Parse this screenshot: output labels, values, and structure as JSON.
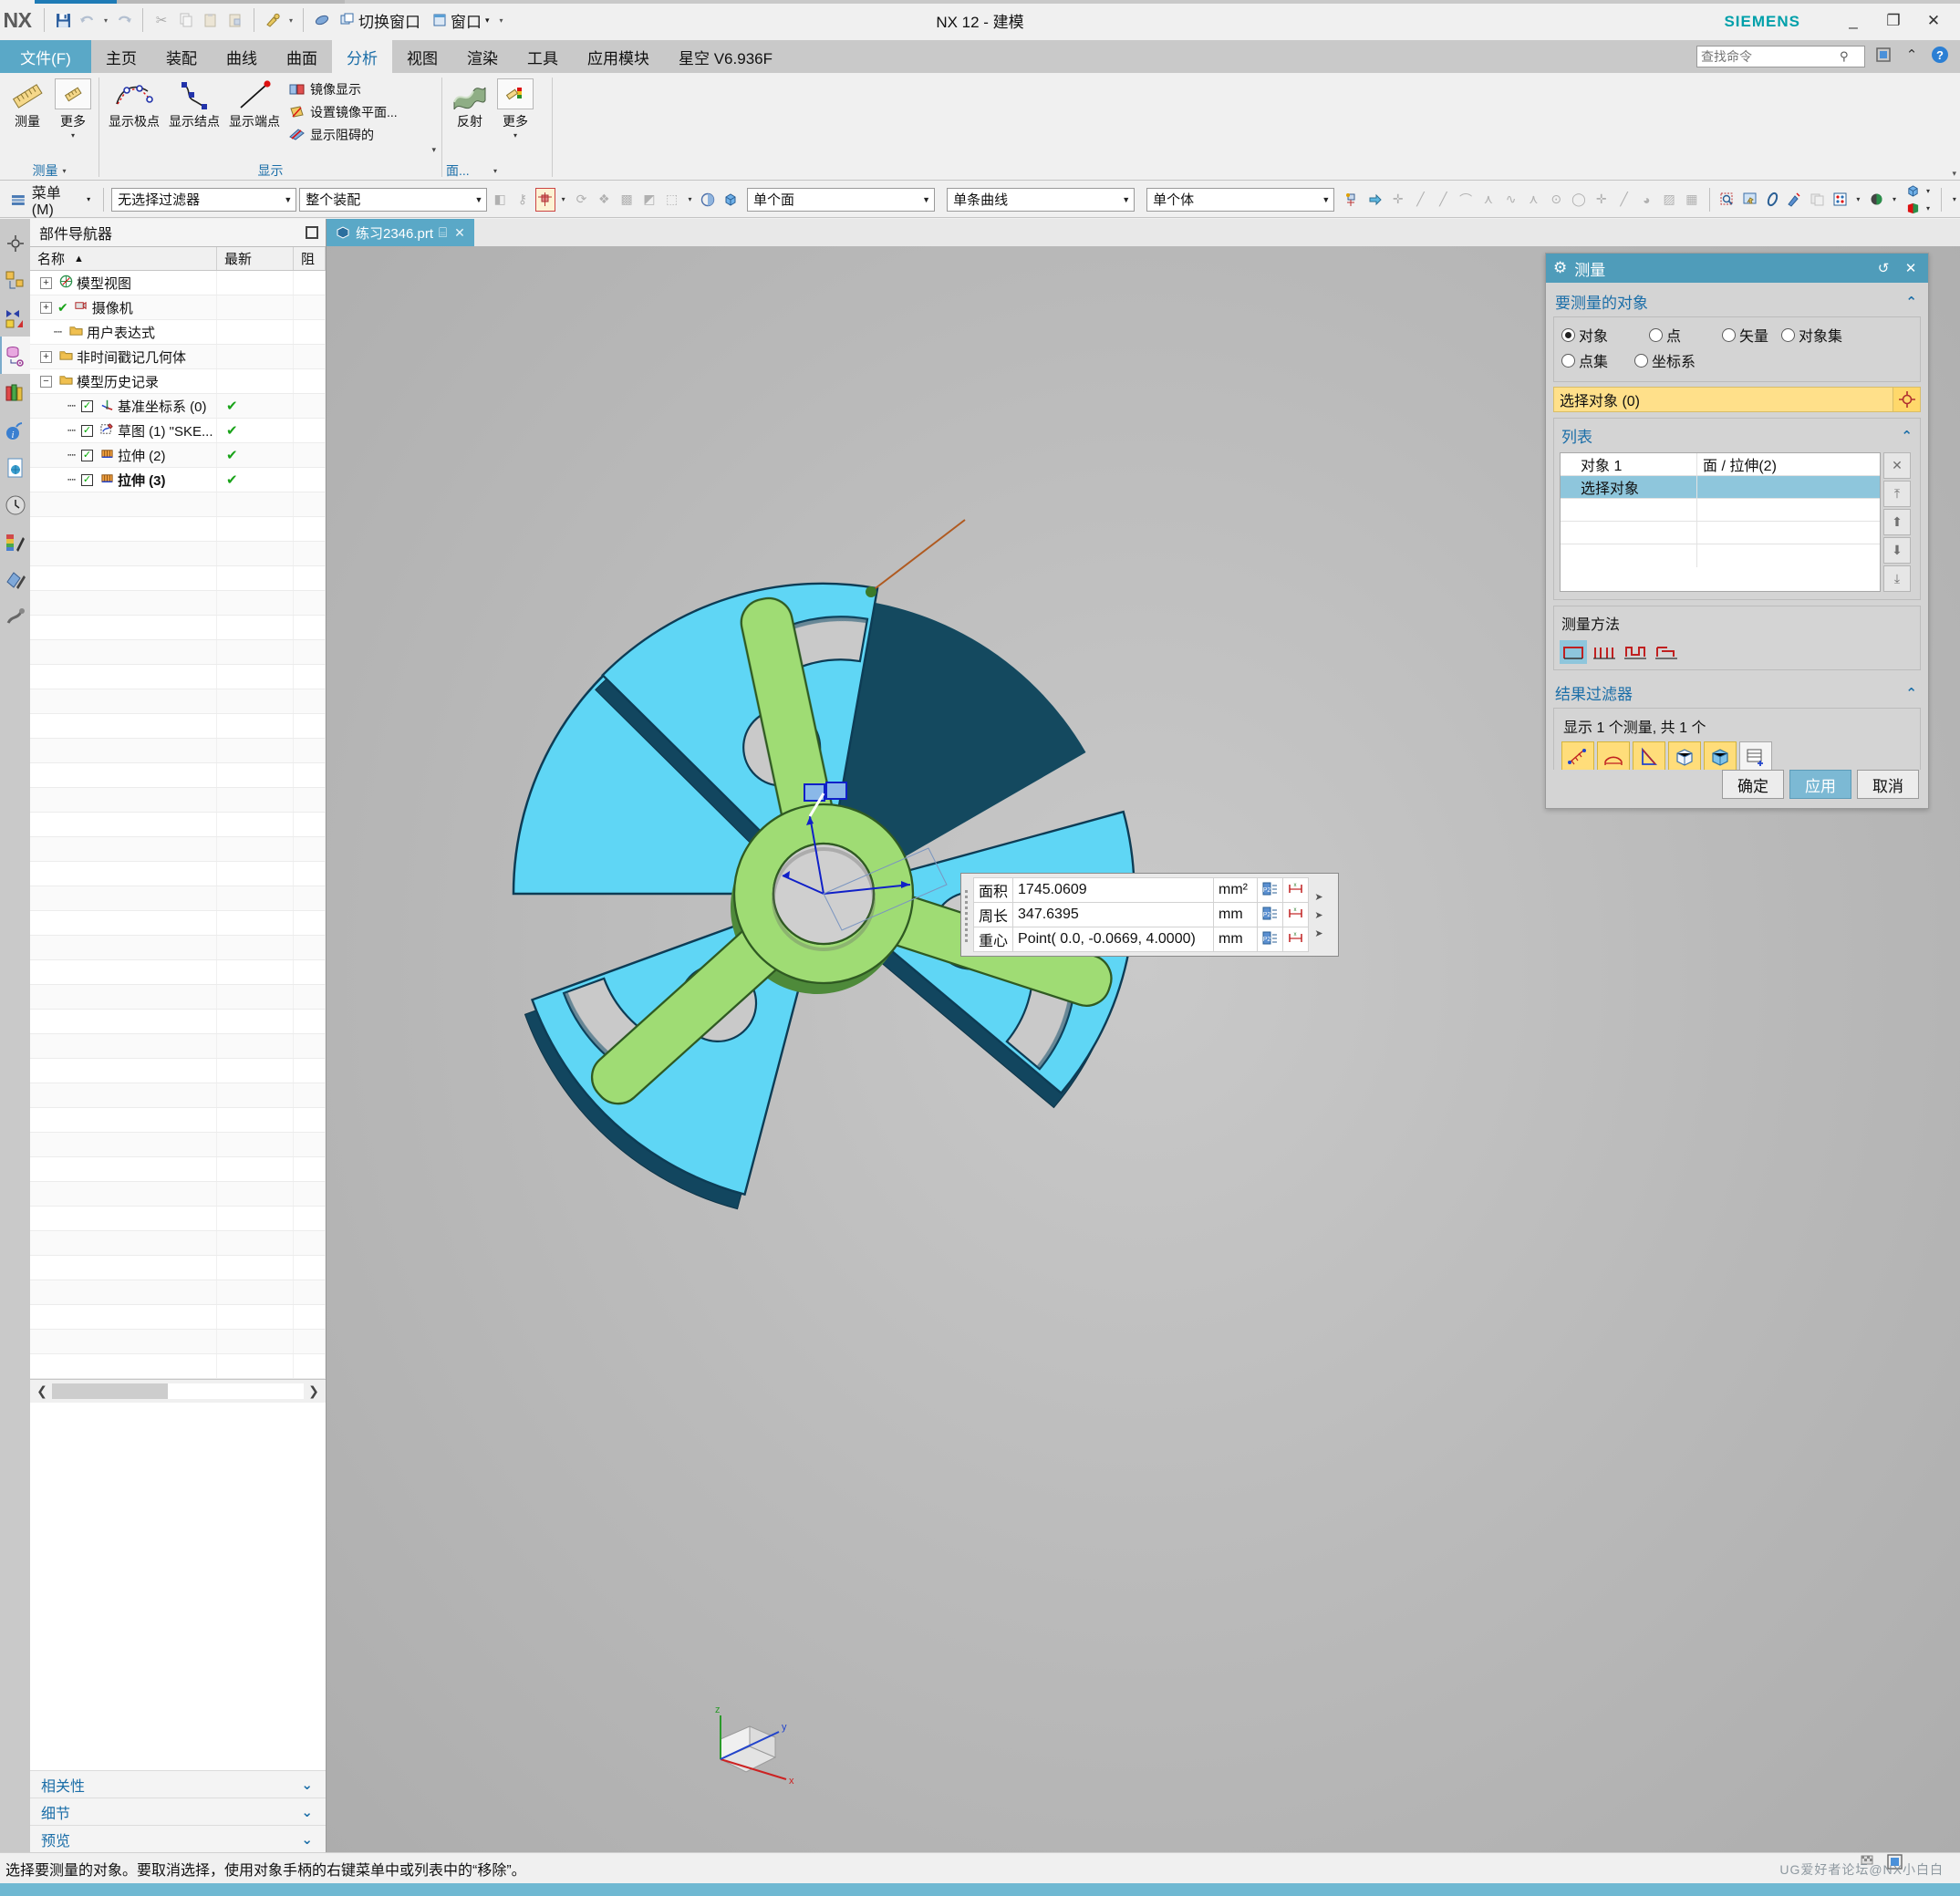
{
  "window": {
    "title": "NX 12 - 建模",
    "brand": "SIEMENS",
    "minimize": "_",
    "maximize": "❐",
    "close": "✕"
  },
  "quick_access": {
    "logo": "NX",
    "buttons": [
      {
        "name": "save-icon",
        "glyph": "💾"
      },
      {
        "name": "undo-icon",
        "glyph": "↰"
      },
      {
        "name": "undo-dropdown-icon",
        "glyph": "▾"
      },
      {
        "name": "redo-icon",
        "glyph": "↱"
      },
      {
        "name": "cut-icon",
        "glyph": "✂"
      },
      {
        "name": "copy-icon",
        "glyph": "❐"
      },
      {
        "name": "paste-icon",
        "glyph": "📋"
      },
      {
        "name": "paste-special-icon",
        "glyph": "❒"
      },
      {
        "name": "undo-history-icon",
        "glyph": "🗝"
      },
      {
        "name": "undo-history-dropdown-icon",
        "glyph": "▾"
      },
      {
        "name": "erase-icon",
        "glyph": "🖌"
      }
    ],
    "switch_window_label": "切换窗口",
    "window_label": "窗口",
    "dropdown_glyph": "▾",
    "more_glyph": "▾"
  },
  "tabs": {
    "file": "文件(F)",
    "items": [
      {
        "label": "主页",
        "active": false
      },
      {
        "label": "装配",
        "active": false
      },
      {
        "label": "曲线",
        "active": false
      },
      {
        "label": "曲面",
        "active": false
      },
      {
        "label": "分析",
        "active": true
      },
      {
        "label": "视图",
        "active": false
      },
      {
        "label": "渲染",
        "active": false
      },
      {
        "label": "工具",
        "active": false
      },
      {
        "label": "应用模块",
        "active": false
      },
      {
        "label": "星空 V6.936F",
        "active": false
      }
    ]
  },
  "search": {
    "placeholder": "查找命令",
    "icon": "search-icon"
  },
  "header_icons": [
    {
      "name": "window-mode-icon",
      "glyph": "▣"
    },
    {
      "name": "collapse-ribbon-icon",
      "glyph": "⌃"
    },
    {
      "name": "help-icon",
      "glyph": "?"
    }
  ],
  "ribbon": {
    "groups": [
      {
        "name": "measure",
        "label": "测量",
        "label_arrow": "▾",
        "buttons": [
          {
            "name": "measure-button",
            "caption": "测量",
            "icon": "ruler-icon",
            "framed": false,
            "dropdown": false
          },
          {
            "name": "measure-more-button",
            "caption": "更多",
            "icon": "ruler-small-icon",
            "framed": true,
            "dropdown": true
          }
        ]
      },
      {
        "name": "display",
        "label": "显示",
        "label_arrow": "▾",
        "buttons": [
          {
            "name": "show-poles-button",
            "caption": "显示极点",
            "icon": "poles-icon",
            "framed": false,
            "dropdown": false
          },
          {
            "name": "show-knots-button",
            "caption": "显示结点",
            "icon": "knots-icon",
            "framed": false,
            "dropdown": false
          },
          {
            "name": "show-endpoints-button",
            "caption": "显示端点",
            "icon": "endpoint-icon",
            "framed": false,
            "dropdown": false
          }
        ],
        "small_items": [
          {
            "name": "mirror-display-item",
            "label": "镜像显示",
            "icon": "mirror-display-icon"
          },
          {
            "name": "set-mirror-plane-item",
            "label": "设置镜像平面...",
            "icon": "mirror-plane-icon"
          },
          {
            "name": "show-obstructed-item",
            "label": "显示阻碍的",
            "icon": "obstructed-icon"
          }
        ]
      },
      {
        "name": "face",
        "label": "面...",
        "label_arrow": "▾",
        "buttons": [
          {
            "name": "reflection-button",
            "caption": "反射",
            "icon": "reflection-icon",
            "framed": false,
            "dropdown": false
          },
          {
            "name": "face-more-button",
            "caption": "更多",
            "icon": "face-more-icon",
            "framed": true,
            "dropdown": true
          }
        ]
      }
    ],
    "far_arrow": "▾"
  },
  "selection_bar": {
    "menu_label": "菜单(M)",
    "menu_icon": "menu-icon",
    "menu_arrow": "▾",
    "filter_combo": {
      "value": "无选择过滤器",
      "arrow": "▼"
    },
    "scope_combo": {
      "value": "整个装配",
      "arrow": "▼"
    },
    "face_combo": {
      "value": "单个面",
      "arrow": "▼"
    },
    "curve_combo": {
      "value": "单条曲线",
      "arrow": "▼"
    },
    "body_combo": {
      "value": "单个体",
      "arrow": "▼"
    },
    "icons_group1": [
      {
        "name": "select-general-icon",
        "glyph": "◧",
        "state": "disabled"
      },
      {
        "name": "select-feature-icon",
        "glyph": "⚷",
        "state": "disabled"
      },
      {
        "name": "snap-point-icon",
        "glyph": "⊹",
        "state": "highlight"
      },
      {
        "name": "snap-dropdown-icon",
        "glyph": "▾",
        "state": "normal"
      },
      {
        "name": "select-component-icon",
        "glyph": "⟳",
        "state": "disabled"
      },
      {
        "name": "select-assembly-icon",
        "glyph": "❖",
        "state": "disabled"
      },
      {
        "name": "select-mesh-icon",
        "glyph": "▩",
        "state": "disabled"
      },
      {
        "name": "select-body2-icon",
        "glyph": "◩",
        "state": "disabled"
      },
      {
        "name": "rect-select-icon",
        "glyph": "⬚",
        "state": "normal"
      },
      {
        "name": "rect-select-dropdown-icon",
        "glyph": "▾",
        "state": "normal"
      },
      {
        "name": "face-color-icon",
        "glyph": "◍",
        "state": "normal"
      },
      {
        "name": "solid-body-icon",
        "glyph": "⬢",
        "state": "normal"
      }
    ],
    "icons_group2": [
      {
        "name": "snap-filter-icon",
        "glyph": "⚵"
      },
      {
        "name": "snap-point-arrow-icon",
        "glyph": "➩"
      },
      {
        "name": "snap-center-icon",
        "glyph": "✛"
      },
      {
        "name": "snap-endpoint-icon",
        "glyph": "╱"
      },
      {
        "name": "snap-midpoint-icon",
        "glyph": "╱"
      },
      {
        "name": "snap-intersection-icon",
        "glyph": "〜"
      },
      {
        "name": "snap-arc-center-icon",
        "glyph": "⋏"
      },
      {
        "name": "snap-quadrant-icon",
        "glyph": "∿"
      },
      {
        "name": "snap-tangent-icon",
        "glyph": "⋀"
      },
      {
        "name": "snap-point-on-curve-icon",
        "glyph": "⊙"
      },
      {
        "name": "snap-circle-icon",
        "glyph": "◯"
      },
      {
        "name": "snap-plus-icon",
        "glyph": "✛"
      },
      {
        "name": "snap-line-icon",
        "glyph": "╱"
      },
      {
        "name": "snap-face-icon",
        "glyph": "◕"
      },
      {
        "name": "snap-surface-icon",
        "glyph": "▨"
      },
      {
        "name": "snap-grid-icon",
        "glyph": "▦"
      }
    ],
    "icons_group3": [
      {
        "name": "zoom-fit-icon",
        "glyph": "🔍"
      },
      {
        "name": "pan-icon",
        "glyph": "✋"
      },
      {
        "name": "rotate-icon",
        "glyph": "⟲"
      },
      {
        "name": "clear-icon",
        "glyph": "🧹"
      },
      {
        "name": "layer-icon",
        "glyph": "▤"
      },
      {
        "name": "grid-icon",
        "glyph": "▦"
      },
      {
        "name": "grid-dropdown-icon",
        "glyph": "▾"
      },
      {
        "name": "render-style-icon",
        "glyph": "◕"
      },
      {
        "name": "render-dropdown-icon",
        "glyph": "▾"
      },
      {
        "name": "view-orient-icon",
        "glyph": "⬢"
      },
      {
        "name": "view-orient-dropdown-icon",
        "glyph": "▾"
      },
      {
        "name": "view-section-icon",
        "glyph": "◩"
      },
      {
        "name": "view-section-dropdown-icon",
        "glyph": "▾"
      },
      {
        "name": "overflow-icon",
        "glyph": "▾"
      }
    ]
  },
  "rail": [
    {
      "name": "rail-assembly-navigator",
      "glyph": "✪",
      "active": false
    },
    {
      "name": "rail-assembly-icon",
      "glyph": "◱",
      "active": false
    },
    {
      "name": "rail-constraint-icon",
      "glyph": "◨",
      "active": false
    },
    {
      "name": "rail-part-navigator",
      "glyph": "◫",
      "active": true
    },
    {
      "name": "rail-reuse-library",
      "glyph": "▥",
      "active": false
    },
    {
      "name": "rail-hd3d-tools",
      "glyph": "ⓘ",
      "active": false
    },
    {
      "name": "rail-web-browser",
      "glyph": "🌐",
      "active": false
    },
    {
      "name": "rail-history",
      "glyph": "🕐",
      "active": false
    },
    {
      "name": "rail-system-scene",
      "glyph": "🎨",
      "active": false
    },
    {
      "name": "rail-system-materials",
      "glyph": "✨",
      "active": false
    },
    {
      "name": "rail-system-visual",
      "glyph": "🔧",
      "active": false
    }
  ],
  "part_navigator": {
    "title": "部件导航器",
    "restore_icon": "restore-icon",
    "columns": [
      "名称",
      "最新",
      "阻"
    ],
    "sort_arrow": "▲",
    "rows": [
      {
        "indent": 0,
        "expander": "+",
        "checkbox": null,
        "icon": "model-views-icon",
        "label": "模型视图",
        "updated": "",
        "bold": false
      },
      {
        "indent": 0,
        "expander": "+",
        "checkbox": null,
        "icon": "camera-icon",
        "label": "摄像机",
        "updated": "",
        "bold": false,
        "prefix_check": true
      },
      {
        "indent": 1,
        "expander": null,
        "checkbox": null,
        "icon": "folder-icon",
        "label": "用户表达式",
        "updated": "",
        "bold": false
      },
      {
        "indent": 0,
        "expander": "+",
        "checkbox": null,
        "icon": "folder-icon",
        "label": "非时间戳记几何体",
        "updated": "",
        "bold": false
      },
      {
        "indent": 0,
        "expander": "−",
        "checkbox": null,
        "icon": "folder-icon",
        "label": "模型历史记录",
        "updated": "",
        "bold": false
      },
      {
        "indent": 2,
        "expander": null,
        "checkbox": "✓",
        "icon": "datum-csys-icon",
        "label": "基准坐标系 (0)",
        "updated": "✔",
        "bold": false
      },
      {
        "indent": 2,
        "expander": null,
        "checkbox": "✓",
        "icon": "sketch-icon",
        "label": "草图 (1) \"SKE...",
        "updated": "✔",
        "bold": false
      },
      {
        "indent": 2,
        "expander": null,
        "checkbox": "✓",
        "icon": "extrude-icon",
        "label": "拉伸 (2)",
        "updated": "✔",
        "bold": false
      },
      {
        "indent": 2,
        "expander": null,
        "checkbox": "✓",
        "icon": "extrude-icon",
        "label": "拉伸 (3)",
        "updated": "✔",
        "bold": true
      }
    ],
    "empty_rows": 36,
    "hscroll": {
      "left_arrow": "❮",
      "right_arrow": "❯"
    },
    "sections": [
      {
        "name": "dependency-section",
        "label": "相关性",
        "chev": "⌄"
      },
      {
        "name": "details-section",
        "label": "细节",
        "chev": "⌄"
      },
      {
        "name": "preview-section",
        "label": "预览",
        "chev": "⌄"
      }
    ]
  },
  "document_tab": {
    "icon": "part-file-icon",
    "label": "练习2346.prt",
    "modified_glyph": "⌸",
    "close_glyph": "✕"
  },
  "measurement_result": {
    "rows": [
      {
        "label": "面积",
        "value": "1745.0609",
        "unit": "mm²",
        "icon1": "point-label-icon",
        "icon2": "dimension-icon"
      },
      {
        "label": "周长",
        "value": "347.6395",
        "unit": "mm",
        "icon1": "point-label-icon",
        "icon2": "dimension-icon"
      },
      {
        "label": "重心",
        "value": "Point( 0.0, -0.0669, 4.0000)",
        "unit": "mm",
        "icon1": "point-label-icon",
        "icon2": "dimension-icon"
      }
    ],
    "side_arrows": [
      "➤",
      "➤",
      "➤"
    ]
  },
  "dialog": {
    "title": "测量",
    "title_icon": "gear-icon",
    "reset_icon": "↺",
    "close_icon": "✕",
    "objects_section": {
      "header": "要测量的对象",
      "chev": "⌃",
      "radios": [
        {
          "name": "radio-object",
          "label": "对象",
          "selected": true
        },
        {
          "name": "radio-point",
          "label": "点",
          "selected": false
        },
        {
          "name": "radio-vector",
          "label": "矢量",
          "selected": false
        },
        {
          "name": "radio-object-set",
          "label": "对象集",
          "selected": false
        },
        {
          "name": "radio-point-set",
          "label": "点集",
          "selected": false
        },
        {
          "name": "radio-csys",
          "label": "坐标系",
          "selected": false
        }
      ],
      "select_row": {
        "label": "选择对象 (0)",
        "target_icon": "crosshair-icon"
      }
    },
    "list_section": {
      "header": "列表",
      "chev": "⌃",
      "rows": [
        {
          "c1": "对象 1",
          "c2": "面 / 拉伸(2)",
          "selected": false
        },
        {
          "c1": "选择对象",
          "c2": "",
          "selected": true
        },
        {
          "c1": "",
          "c2": "",
          "selected": false
        },
        {
          "c1": "",
          "c2": "",
          "selected": false
        },
        {
          "c1": "",
          "c2": "",
          "selected": false
        }
      ],
      "side_buttons": [
        {
          "name": "remove-item-button",
          "glyph": "✕"
        },
        {
          "name": "move-to-top-button",
          "glyph": "⤒"
        },
        {
          "name": "move-up-button",
          "glyph": "⬆"
        },
        {
          "name": "move-down-button",
          "glyph": "⬇"
        },
        {
          "name": "move-to-bottom-button",
          "glyph": "⤓"
        }
      ]
    },
    "method_section": {
      "header": "测量方法",
      "icons": [
        {
          "name": "method-simple-icon",
          "glyph": "⊓",
          "active": true
        },
        {
          "name": "method-parallel-icon",
          "glyph": "⑊",
          "active": false
        },
        {
          "name": "method-chain-icon",
          "glyph": "⊔",
          "active": false
        },
        {
          "name": "method-step-icon",
          "glyph": "⊐",
          "active": false
        }
      ]
    },
    "result_filter": {
      "header": "结果过滤器",
      "chev": "⌃",
      "summary": "显示 1 个测量, 共 1 个",
      "icons": [
        {
          "name": "filter-distance-icon",
          "glyph": "⋰",
          "highlight": true
        },
        {
          "name": "filter-angle-icon",
          "glyph": "⌒",
          "highlight": true
        },
        {
          "name": "filter-radius-icon",
          "glyph": "◺",
          "highlight": true
        },
        {
          "name": "filter-volume-icon",
          "glyph": "⬜",
          "highlight": true
        },
        {
          "name": "filter-area-icon",
          "glyph": "⬛",
          "highlight": true
        },
        {
          "name": "filter-add-icon",
          "glyph": "▤",
          "highlight": false
        }
      ]
    },
    "expand_arrow": "▼",
    "buttons": [
      {
        "name": "ok-button",
        "label": "确定",
        "primary": false
      },
      {
        "name": "apply-button",
        "label": "应用",
        "primary": true
      },
      {
        "name": "cancel-button",
        "label": "取消",
        "primary": false
      }
    ]
  },
  "status_bar": {
    "message": "选择要测量的对象。要取消选择，使用对象手柄的右键菜单中或列表中的“移除”。",
    "watermark": "UG爱好者论坛@NX小白白"
  }
}
